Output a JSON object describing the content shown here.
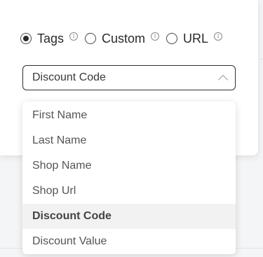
{
  "source_type": {
    "options": [
      {
        "label": "Tags",
        "checked": true
      },
      {
        "label": "Custom",
        "checked": false
      },
      {
        "label": "URL",
        "checked": false
      }
    ],
    "info_glyph": "i"
  },
  "select": {
    "value": "Discount Code"
  },
  "menu": {
    "items": [
      {
        "label": "First Name"
      },
      {
        "label": "Last Name"
      },
      {
        "label": "Shop Name"
      },
      {
        "label": "Shop Url"
      },
      {
        "label": "Discount Code"
      },
      {
        "label": "Discount Value"
      }
    ],
    "selected": "Discount Code"
  },
  "colors": {
    "border_dark": "#2c2f3a",
    "selected_bg": "#f2f2f2"
  }
}
